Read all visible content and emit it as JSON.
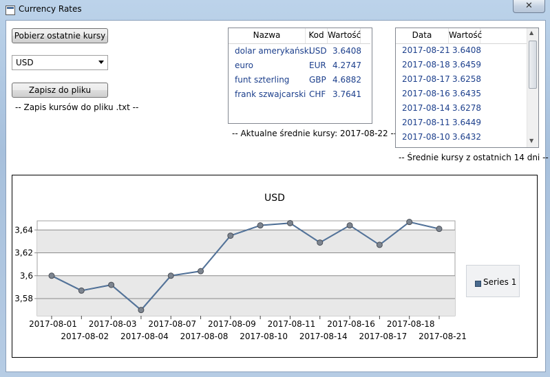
{
  "window": {
    "title": "Currency Rates",
    "close_glyph": "✕"
  },
  "controls": {
    "fetch_button": "Pobierz ostatnie kursy",
    "currency_selected": "USD",
    "save_button": "Zapisz do pliku",
    "save_note": "-- Zapis kursów do pliku .txt --"
  },
  "rates_table": {
    "headers": [
      "Nazwa",
      "Kod",
      "Wartość"
    ],
    "rows": [
      [
        "dolar amerykański",
        "USD",
        "3.6408"
      ],
      [
        "euro",
        "EUR",
        "4.2747"
      ],
      [
        "funt szterling",
        "GBP",
        "4.6882"
      ],
      [
        "frank szwajcarski",
        "CHF",
        "3.7641"
      ]
    ],
    "caption": "-- Aktualne średnie kursy: 2017-08-22 --"
  },
  "history_table": {
    "headers": [
      "Data",
      "Wartość"
    ],
    "rows": [
      [
        "2017-08-21",
        "3.6408"
      ],
      [
        "2017-08-18",
        "3.6459"
      ],
      [
        "2017-08-17",
        "3.6258"
      ],
      [
        "2017-08-16",
        "3.6435"
      ],
      [
        "2017-08-14",
        "3.6278"
      ],
      [
        "2017-08-11",
        "3.6449"
      ],
      [
        "2017-08-10",
        "3.6432"
      ]
    ],
    "caption": "-- Średnie kursy z ostatnich 14 dni --",
    "scroll_up": "▲",
    "scroll_down": "▼"
  },
  "chart_data": {
    "type": "line",
    "title": "USD",
    "xlabel": "",
    "ylabel": "",
    "categories": [
      "2017-08-01",
      "2017-08-02",
      "2017-08-03",
      "2017-08-04",
      "2017-08-07",
      "2017-08-08",
      "2017-08-09",
      "2017-08-10",
      "2017-08-11",
      "2017-08-14",
      "2017-08-16",
      "2017-08-17",
      "2017-08-18",
      "2017-08-21"
    ],
    "series": [
      {
        "name": "Series 1",
        "values": [
          3.6,
          3.587,
          3.592,
          3.57,
          3.6,
          3.604,
          3.635,
          3.644,
          3.646,
          3.629,
          3.644,
          3.627,
          3.647,
          3.641
        ]
      }
    ],
    "ylim": [
      3.565,
      3.648
    ],
    "yticks": [
      "3,58",
      "3,6",
      "3,62",
      "3,64"
    ],
    "ytick_values": [
      3.58,
      3.6,
      3.62,
      3.64
    ],
    "grid": true,
    "legend_position": "right",
    "colors": {
      "line": "#6a8fb8",
      "marker": "#7d8590",
      "plot_band": "#e8e8e8"
    }
  }
}
